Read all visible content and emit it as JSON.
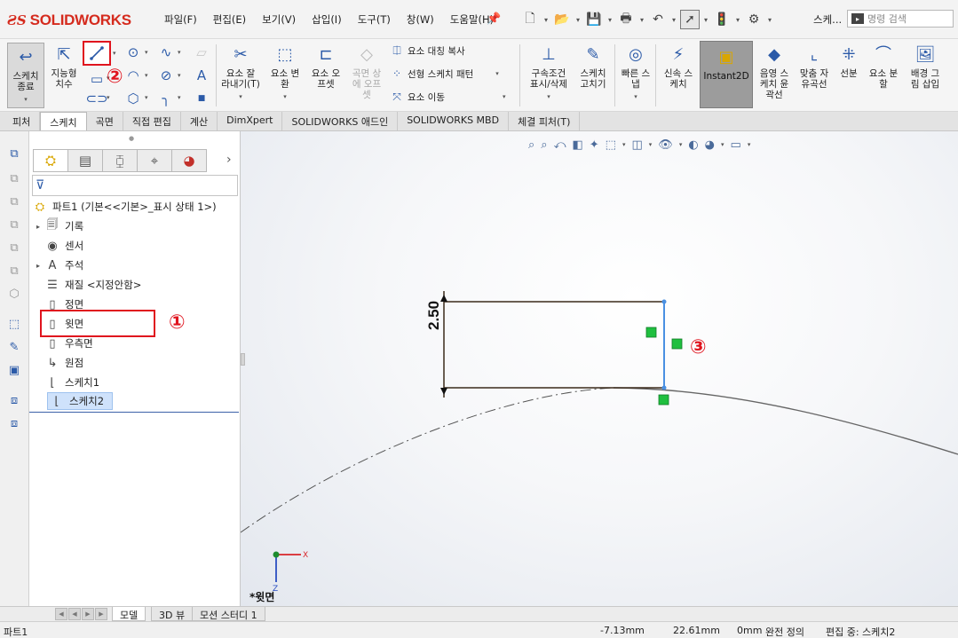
{
  "app": {
    "logo_text": "SOLIDWORKS",
    "title_short": "스케..."
  },
  "menus": [
    "파일(F)",
    "편집(E)",
    "보기(V)",
    "삽입(I)",
    "도구(T)",
    "창(W)",
    "도움말(H)"
  ],
  "search": {
    "placeholder": "명령 검색"
  },
  "ribbon": {
    "sketch_end": "스케치\n종료",
    "smart_dim": "지능형\n치수",
    "trim": "요소 잘\n라내기(T)",
    "convert": "요소 변\n환",
    "offset": "요소 오\n프셋",
    "surface_offset": "곡면 상\n에 오프\n셋",
    "mirror": "요소 대칭 복사",
    "linear_pattern": "선형 스케치 패턴",
    "move": "요소 이동",
    "relations": "구속조건\n표시/삭제",
    "repair": "스케치\n고치기",
    "quick_snap": "빠른 스\n냅",
    "rapid_sketch": "신속 스\n케치",
    "instant2d": "Instant2D",
    "shaded": "음영 스\n케치 윤\n곽선",
    "spline": "맞춤 자\n유곡선",
    "segment": "선분",
    "split": "요소 분\n할",
    "sketch_picture": "배경 그\n림 삽입"
  },
  "tabs": [
    "피처",
    "스케치",
    "곡면",
    "직접 편집",
    "계산",
    "DimXpert",
    "SOLIDWORKS 애드인",
    "SOLIDWORKS MBD",
    "체결 피처(T)"
  ],
  "active_tab": "스케치",
  "tree": {
    "root": "파트1  (기본<<기본>_표시 상태 1>)",
    "items": [
      "기록",
      "센서",
      "주석",
      "재질 <지정안함>",
      "정면",
      "윗면",
      "우측면",
      "원점",
      "스케치1",
      "스케치2"
    ]
  },
  "callouts": [
    "①",
    "②",
    "③"
  ],
  "sketch": {
    "dimension": "2.50"
  },
  "view_name": "*윗면",
  "bottom_tabs": [
    "모델",
    "3D 뷰",
    "모션 스터디 1"
  ],
  "status": {
    "doc": "파트1",
    "x": "-7.13mm",
    "y": "22.61mm",
    "z": "0mm",
    "define": "완전 정의",
    "editing": "편집 중: 스케치2"
  },
  "icons": {
    "sketch_end": "sketch-exit-icon",
    "line": "line-icon",
    "circle": "circle-icon",
    "tree_sketch": "sketch-icon",
    "plane": "plane-icon"
  },
  "colors": {
    "brand_red": "#d52b1e",
    "callout_red": "#e0141e",
    "selected_line": "#4a90e2",
    "relation_green": "#1fbf3f"
  }
}
